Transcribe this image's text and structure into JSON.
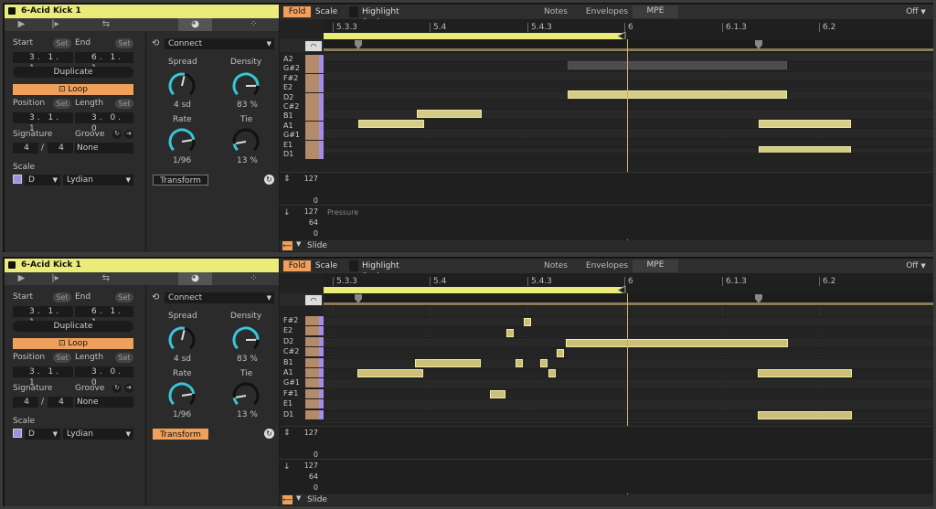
{
  "panels": [
    {
      "clip_name": "6-Acid Kick 1",
      "tabs": [
        "▶",
        "|▸",
        "⇆",
        "◕",
        "⁘"
      ],
      "active_tab": 3,
      "start": {
        "label": "Start",
        "set": "Set",
        "bars": "3",
        "beats": "1",
        "sixteenths": "1"
      },
      "end": {
        "label": "End",
        "set": "Set",
        "bars": "6",
        "beats": "1",
        "sixteenths": "1"
      },
      "duplicate": "Duplicate",
      "loop": "Loop",
      "position": {
        "label": "Position",
        "set": "Set",
        "bars": "3",
        "beats": "1",
        "sixteenths": "1"
      },
      "length": {
        "label": "Length",
        "set": "Set",
        "bars": "3",
        "beats": "0",
        "sixteenths": "0"
      },
      "signature": {
        "label": "Signature",
        "num": "4",
        "sep": "/",
        "den": "4"
      },
      "groove": {
        "label": "Groove",
        "value": "None"
      },
      "scale": {
        "label": "Scale",
        "root": "D",
        "mode": "Lydian"
      },
      "transform_mode": "Connect",
      "spread": {
        "label": "Spread",
        "value": "4 sd",
        "level": 0.55
      },
      "density": {
        "label": "Density",
        "value": "83 %",
        "level": 0.83
      },
      "rate": {
        "label": "Rate",
        "value": "1/96",
        "level": 0.8
      },
      "tie": {
        "label": "Tie",
        "value": "13 %",
        "level": 0.13
      },
      "transform": "Transform",
      "transform_on": false,
      "toolbar": {
        "fold": "Fold",
        "scale": "Scale",
        "highlight": "Highlight Scale",
        "notes": "Notes",
        "envelopes": "Envelopes",
        "mpe": "MPE",
        "off": "Off"
      },
      "ruler": [
        "5.3.3",
        "5.4",
        "5.4.3",
        "6",
        "6.1.3",
        "6.2"
      ],
      "keys": [
        "A2",
        "G#2",
        "F#2",
        "E2",
        "D2",
        "C#2",
        "B1",
        "A1",
        "G#1",
        "E1",
        "D1"
      ],
      "lane1": {
        "top": "127",
        "bottom": "0"
      },
      "lane2": {
        "label": "Pressure",
        "top": "127",
        "mid": "64",
        "bottom": "0"
      },
      "footer_label": "Slide"
    },
    {
      "clip_name": "6-Acid Kick 1",
      "tabs": [
        "▶",
        "|▸",
        "⇆",
        "◕",
        "⁘"
      ],
      "active_tab": 3,
      "start": {
        "label": "Start",
        "set": "Set",
        "bars": "3",
        "beats": "1",
        "sixteenths": "1"
      },
      "end": {
        "label": "End",
        "set": "Set",
        "bars": "6",
        "beats": "1",
        "sixteenths": "1"
      },
      "duplicate": "Duplicate",
      "loop": "Loop",
      "position": {
        "label": "Position",
        "set": "Set",
        "bars": "3",
        "beats": "1",
        "sixteenths": "1"
      },
      "length": {
        "label": "Length",
        "set": "Set",
        "bars": "3",
        "beats": "0",
        "sixteenths": "0"
      },
      "signature": {
        "label": "Signature",
        "num": "4",
        "sep": "/",
        "den": "4"
      },
      "groove": {
        "label": "Groove",
        "value": "None"
      },
      "scale": {
        "label": "Scale",
        "root": "D",
        "mode": "Lydian"
      },
      "transform_mode": "Connect",
      "spread": {
        "label": "Spread",
        "value": "4 sd",
        "level": 0.55
      },
      "density": {
        "label": "Density",
        "value": "83 %",
        "level": 0.83
      },
      "rate": {
        "label": "Rate",
        "value": "1/96",
        "level": 0.8
      },
      "tie": {
        "label": "Tie",
        "value": "13 %",
        "level": 0.13
      },
      "transform": "Transform",
      "transform_on": true,
      "toolbar": {
        "fold": "Fold",
        "scale": "Scale",
        "highlight": "Highlight Scale",
        "notes": "Notes",
        "envelopes": "Envelopes",
        "mpe": "MPE",
        "off": "Off"
      },
      "ruler": [
        "5.3.3",
        "5.4",
        "5.4.3",
        "6",
        "6.1.3",
        "6.2"
      ],
      "keys": [
        "F#2",
        "E2",
        "D2",
        "C#2",
        "B1",
        "A1",
        "G#1",
        "F#1",
        "E1",
        "D1"
      ],
      "lane1": {
        "top": "127",
        "bottom": "0"
      },
      "lane2": {
        "top": "127",
        "mid": "64",
        "bottom": "0"
      },
      "footer_label": "Slide"
    }
  ],
  "colors": {
    "accent": "#f0a05a",
    "clip": "#eaeb78",
    "note": "#d5cc88",
    "key_purple": "#a58ce6"
  }
}
